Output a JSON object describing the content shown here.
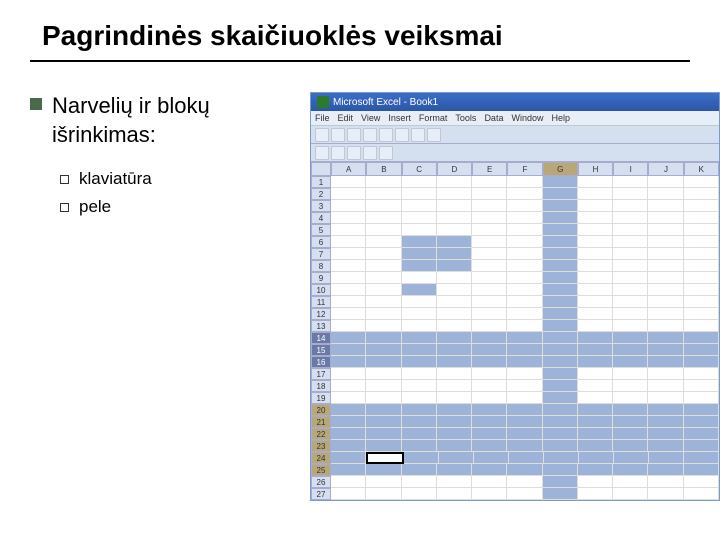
{
  "slide": {
    "title": "Pagrindinės skaičiuoklės veiksmai",
    "heading": "Narvelių ir blokų išrinkimas:",
    "bullets": [
      "klaviatūra",
      "pele"
    ]
  },
  "excel": {
    "window_title": "Microsoft Excel - Book1",
    "menu": [
      "File",
      "Edit",
      "View",
      "Insert",
      "Format",
      "Tools",
      "Data",
      "Window",
      "Help"
    ],
    "columns": [
      "A",
      "B",
      "C",
      "D",
      "E",
      "F",
      "G",
      "H",
      "I",
      "J",
      "K"
    ],
    "rows": [
      "1",
      "2",
      "3",
      "4",
      "5",
      "6",
      "7",
      "8",
      "9",
      "10",
      "11",
      "12",
      "13",
      "14",
      "15",
      "16",
      "17",
      "18",
      "19",
      "20",
      "21",
      "22",
      "23",
      "24",
      "25",
      "26",
      "27"
    ],
    "selected_rows_full": [
      "14",
      "15",
      "16"
    ],
    "selected_rows_partial": [
      "20",
      "21",
      "22",
      "23",
      "24",
      "25"
    ],
    "selected_block": {
      "cols": [
        "C",
        "D"
      ],
      "rows": [
        "6",
        "7",
        "8"
      ]
    },
    "selected_column": "G",
    "active_cell": {
      "row": "24",
      "col": "B"
    },
    "single_sel": {
      "row": "10",
      "col": "C"
    }
  }
}
